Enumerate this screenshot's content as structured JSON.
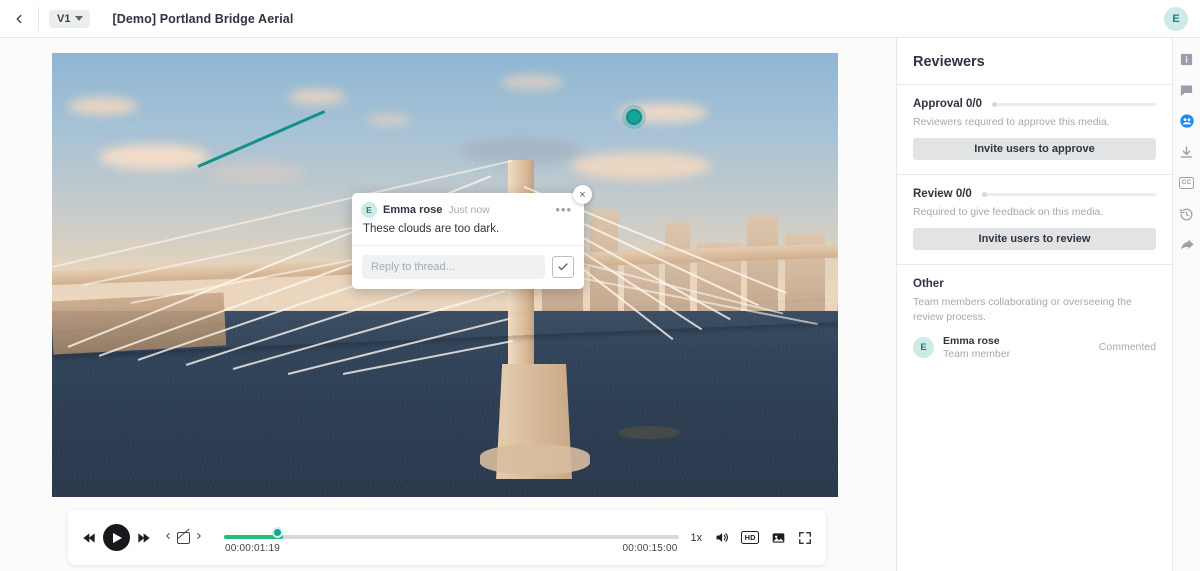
{
  "topbar": {
    "back_icon": "chevron-left-icon",
    "version_label": "V1",
    "title": "[Demo] Portland Bridge Aerial",
    "avatar_initial": "E"
  },
  "comment_popup": {
    "avatar_initial": "E",
    "author": "Emma rose",
    "timestamp": "Just now",
    "more_label": "•••",
    "close_label": "×",
    "text": "These clouds are too dark.",
    "reply_placeholder": "Reply to thread...",
    "reply_value": "",
    "confirm_label": "✓"
  },
  "player": {
    "skip_back_icon": "skip-back-icon",
    "play_icon": "play-icon",
    "skip_forward_icon": "skip-forward-icon",
    "prev_comment_icon": "chevron-left-icon",
    "comment_marker_icon": "annotation-icon",
    "next_comment_icon": "chevron-right-icon",
    "current_time": "00:00:01:19",
    "total_time": "00:00:15:00",
    "progress_percent": 13,
    "playhead_percent": 10.5,
    "speed_label": "1x",
    "volume_icon": "volume-icon",
    "quality_label": "HD",
    "picture_icon": "picture-icon",
    "fullscreen_icon": "fullscreen-icon",
    "colors": {
      "progress": "#1fc07a",
      "playhead": "#16a39a"
    }
  },
  "sidebar": {
    "title": "Reviewers",
    "sections": [
      {
        "heading": "Approval 0/0",
        "description": "Reviewers required to approve this media.",
        "button_label": "Invite users to approve"
      },
      {
        "heading": "Review 0/0",
        "description": "Required to give feedback on this media.",
        "button_label": "Invite users to review"
      }
    ],
    "other": {
      "heading": "Other",
      "description": "Team members collaborating or overseeing the review process.",
      "member": {
        "avatar_initial": "E",
        "name": "Emma rose",
        "role": "Team member",
        "status": "Commented"
      }
    }
  },
  "rail": {
    "items": [
      {
        "icon": "info-icon",
        "active": false
      },
      {
        "icon": "comment-icon",
        "active": false
      },
      {
        "icon": "people-icon",
        "active": true
      },
      {
        "icon": "download-icon",
        "active": false
      },
      {
        "icon": "cc-icon",
        "label": "CC",
        "active": false
      },
      {
        "icon": "history-icon",
        "active": false
      },
      {
        "icon": "share-icon",
        "active": false
      }
    ],
    "active_color": "#1f8df0"
  },
  "annotation": {
    "pin_color": "#16a39a",
    "connector_color": "#12908a"
  }
}
